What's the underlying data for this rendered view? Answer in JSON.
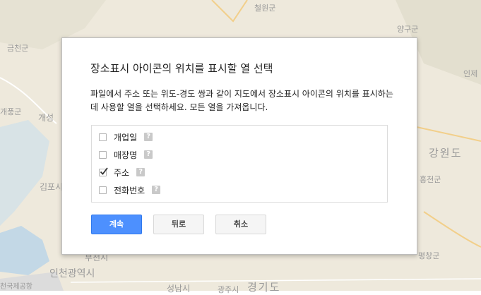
{
  "map": {
    "labels": [
      {
        "text": "철원군"
      },
      {
        "text": "양구군"
      },
      {
        "text": "금천군"
      },
      {
        "text": "인제"
      },
      {
        "text": "개풍군"
      },
      {
        "text": "개성"
      },
      {
        "text": "강원도"
      },
      {
        "text": "김포시"
      },
      {
        "text": "홍천군"
      },
      {
        "text": "부천시"
      },
      {
        "text": "인천광역시"
      },
      {
        "text": "평창군"
      },
      {
        "text": "천국제공항"
      },
      {
        "text": "성남시"
      },
      {
        "text": "광주시"
      },
      {
        "text": "경기도"
      }
    ]
  },
  "dialog": {
    "title": "장소표시 아이콘의 위치를 표시할 열 선택",
    "description": "파일에서 주소 또는 위도-경도 쌍과 같이 지도에서 장소표시 아이콘의 위치를 표시하는 데 사용할 열을 선택하세요. 모든 열을 가져옵니다.",
    "columns": [
      {
        "label": "개업일",
        "checked": false
      },
      {
        "label": "매장명",
        "checked": false
      },
      {
        "label": "주소",
        "checked": true
      },
      {
        "label": "전화번호",
        "checked": false
      }
    ],
    "help_glyph": "?",
    "buttons": {
      "continue": "계속",
      "back": "뒤로",
      "cancel": "취소"
    }
  }
}
